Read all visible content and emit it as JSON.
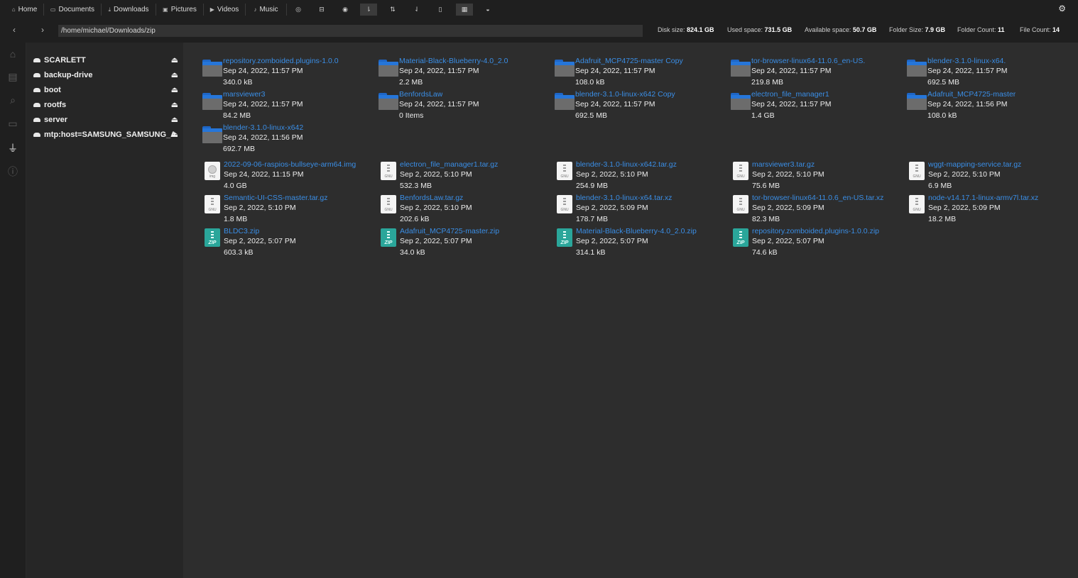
{
  "toolbar": {
    "home": "Home",
    "documents": "Documents",
    "downloads": "Downloads",
    "pictures": "Pictures",
    "videos": "Videos",
    "music": "Music"
  },
  "address": {
    "path": "/home/michael/Downloads/zip"
  },
  "stats": {
    "disk_label": "Disk size:",
    "disk_value": "824.1 GB",
    "used_label": "Used space:",
    "used_value": "731.5 GB",
    "avail_label": "Available space:",
    "avail_value": "50.7 GB",
    "folder_size_label": "Folder Size:",
    "folder_size_value": "7.9 GB",
    "folder_count_label": "Folder Count:",
    "folder_count_value": "11",
    "file_count_label": "File Count:",
    "file_count_value": "14"
  },
  "sidebar": {
    "drives": [
      {
        "label": "SCARLETT"
      },
      {
        "label": "backup-drive"
      },
      {
        "label": "boot"
      },
      {
        "label": "rootfs"
      },
      {
        "label": "server"
      },
      {
        "label": "mtp:host=SAMSUNG_SAMSUNG_Android"
      }
    ]
  },
  "folders": [
    {
      "name": "repository.zomboided.plugins-1.0.0",
      "date": "Sep 24, 2022, 11:57 PM",
      "size": "340.0 kB"
    },
    {
      "name": "Material-Black-Blueberry-4.0_2.0",
      "date": "Sep 24, 2022, 11:57 PM",
      "size": "2.2 MB"
    },
    {
      "name": "Adafruit_MCP4725-master Copy",
      "date": "Sep 24, 2022, 11:57 PM",
      "size": "108.0 kB"
    },
    {
      "name": "tor-browser-linux64-11.0.6_en-US.",
      "date": "Sep 24, 2022, 11:57 PM",
      "size": "219.8 MB"
    },
    {
      "name": "blender-3.1.0-linux-x64.",
      "date": "Sep 24, 2022, 11:57 PM",
      "size": "692.5 MB"
    },
    {
      "name": "marsviewer3",
      "date": "Sep 24, 2022, 11:57 PM",
      "size": "84.2 MB"
    },
    {
      "name": "BenfordsLaw",
      "date": "Sep 24, 2022, 11:57 PM",
      "size": "0 Items"
    },
    {
      "name": "blender-3.1.0-linux-x642 Copy",
      "date": "Sep 24, 2022, 11:57 PM",
      "size": "692.5 MB"
    },
    {
      "name": "electron_file_manager1",
      "date": "Sep 24, 2022, 11:57 PM",
      "size": "1.4 GB"
    },
    {
      "name": "Adafruit_MCP4725-master",
      "date": "Sep 24, 2022, 11:56 PM",
      "size": "108.0 kB"
    },
    {
      "name": "blender-3.1.0-linux-x642",
      "date": "Sep 24, 2022, 11:56 PM",
      "size": "692.7 MB"
    }
  ],
  "files": [
    {
      "name": "2022-09-06-raspios-bullseye-arm64.img",
      "date": "Sep 24, 2022, 11:15 PM",
      "size": "4.0 GB",
      "type": "img",
      "icon_label": "img"
    },
    {
      "name": "electron_file_manager1.tar.gz",
      "date": "Sep 2, 2022, 5:10 PM",
      "size": "532.3 MB",
      "type": "archive",
      "icon_label": "GNU"
    },
    {
      "name": "blender-3.1.0-linux-x642.tar.gz",
      "date": "Sep 2, 2022, 5:10 PM",
      "size": "254.9 MB",
      "type": "archive",
      "icon_label": "GNU"
    },
    {
      "name": "marsviewer3.tar.gz",
      "date": "Sep 2, 2022, 5:10 PM",
      "size": "75.6 MB",
      "type": "archive",
      "icon_label": "GNU"
    },
    {
      "name": "wggt-mapping-service.tar.gz",
      "date": "Sep 2, 2022, 5:10 PM",
      "size": "6.9 MB",
      "type": "archive",
      "icon_label": "GNU"
    },
    {
      "name": "Semantic-UI-CSS-master.tar.gz",
      "date": "Sep 2, 2022, 5:10 PM",
      "size": "1.8 MB",
      "type": "archive",
      "icon_label": "GNU"
    },
    {
      "name": "BenfordsLaw.tar.gz",
      "date": "Sep 2, 2022, 5:10 PM",
      "size": "202.6 kB",
      "type": "archive",
      "icon_label": "GNU"
    },
    {
      "name": "blender-3.1.0-linux-x64.tar.xz",
      "date": "Sep 2, 2022, 5:09 PM",
      "size": "178.7 MB",
      "type": "archive",
      "icon_label": "GNU"
    },
    {
      "name": "tor-browser-linux64-11.0.6_en-US.tar.xz",
      "date": "Sep 2, 2022, 5:09 PM",
      "size": "82.3 MB",
      "type": "archive",
      "icon_label": "GNU"
    },
    {
      "name": "node-v14.17.1-linux-armv7l.tar.xz",
      "date": "Sep 2, 2022, 5:09 PM",
      "size": "18.2 MB",
      "type": "archive",
      "icon_label": "GNU"
    },
    {
      "name": "BLDC3.zip",
      "date": "Sep 2, 2022, 5:07 PM",
      "size": "603.3 kB",
      "type": "zip",
      "icon_label": "ZIP"
    },
    {
      "name": "Adafruit_MCP4725-master.zip",
      "date": "Sep 2, 2022, 5:07 PM",
      "size": "34.0 kB",
      "type": "zip",
      "icon_label": "ZIP"
    },
    {
      "name": "Material-Black-Blueberry-4.0_2.0.zip",
      "date": "Sep 2, 2022, 5:07 PM",
      "size": "314.1 kB",
      "type": "zip",
      "icon_label": "ZIP"
    },
    {
      "name": "repository.zomboided.plugins-1.0.0.zip",
      "date": "Sep 2, 2022, 5:07 PM",
      "size": "74.6 kB",
      "type": "zip",
      "icon_label": "ZIP"
    }
  ]
}
